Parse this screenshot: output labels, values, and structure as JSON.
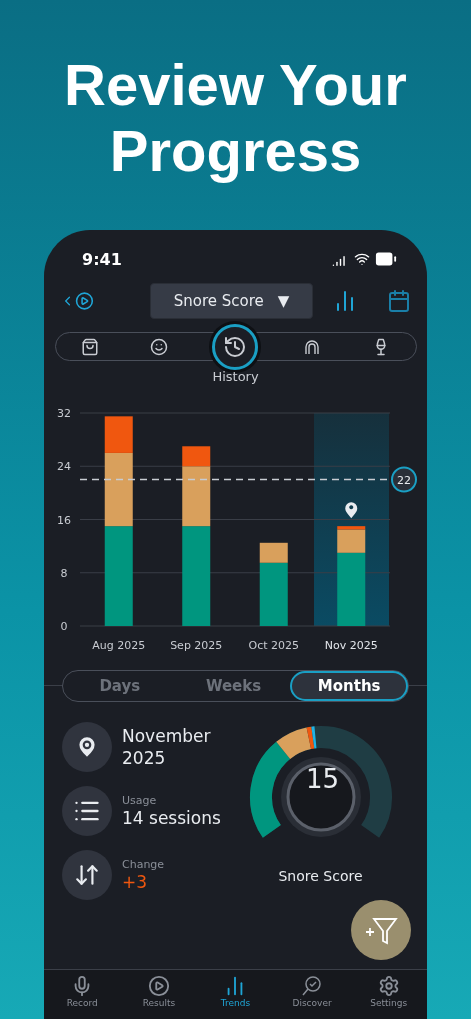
{
  "headline": "Review Your Progress",
  "status_bar": {
    "time": "9:41"
  },
  "header": {
    "metric": "Snore Score",
    "dropdown_arrow": "▼"
  },
  "filters": [
    {
      "selected": false
    },
    {
      "selected": false
    },
    {
      "selected": true,
      "label": "History"
    },
    {
      "selected": false
    },
    {
      "selected": false
    }
  ],
  "chart_data": {
    "type": "bar",
    "stacked": true,
    "categories": [
      "Aug 2025",
      "Sep 2025",
      "Oct 2025",
      "Nov 2025"
    ],
    "series": [
      {
        "color": "#00967f",
        "values": [
          15,
          15,
          9.5,
          11
        ]
      },
      {
        "color": "#d9a05c",
        "values": [
          11,
          9,
          3,
          3.5
        ]
      },
      {
        "color": "#f0570f",
        "values": [
          5.5,
          3,
          0,
          0.5
        ]
      }
    ],
    "ylim": [
      0,
      32
    ],
    "yticks": [
      0,
      8,
      16,
      24,
      32
    ],
    "grid": true,
    "ref_lines": [
      {
        "axis": "y",
        "value": 22,
        "label": "22"
      }
    ]
  },
  "chart_columns": [
    {
      "selected": false
    },
    {
      "selected": false
    },
    {
      "selected": false
    },
    {
      "selected": true
    }
  ],
  "periods": [
    {
      "label": "Days",
      "selected": false
    },
    {
      "label": "Weeks",
      "selected": false
    },
    {
      "label": "Months",
      "selected": true
    }
  ],
  "stats": [
    {
      "kind": "location",
      "value": "November 2025"
    },
    {
      "kind": "usage",
      "label": "Usage",
      "value": "14 sessions"
    },
    {
      "kind": "change",
      "label": "Change",
      "value": "+3"
    }
  ],
  "gauge": {
    "value": "15",
    "label": "Snore Score"
  },
  "nav": [
    {
      "label": "Record",
      "selected": false
    },
    {
      "label": "Results",
      "selected": false
    },
    {
      "label": "Trends",
      "selected": true
    },
    {
      "label": "Discover",
      "selected": false
    },
    {
      "label": "Settings",
      "selected": false
    }
  ]
}
